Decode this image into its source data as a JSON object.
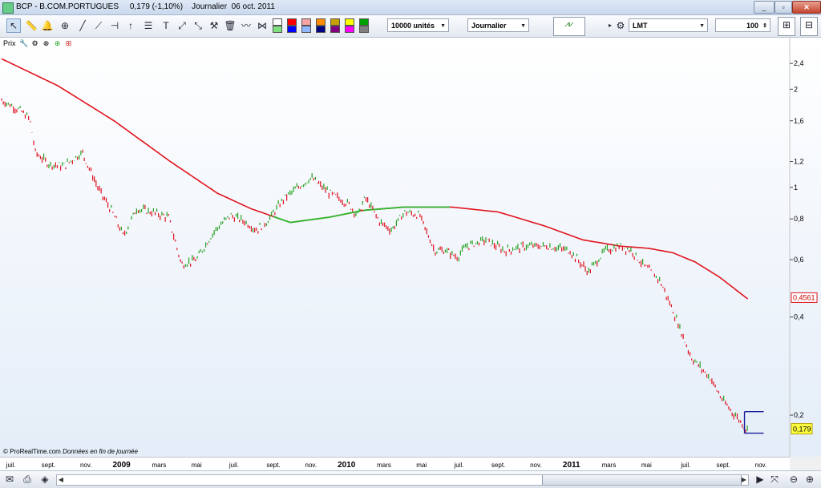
{
  "window": {
    "title": "BCP - B.COM.PORTUGUES     0,179 (-1,10%)    Journalier  06 oct. 2011",
    "minimize": "_",
    "restore": "▫",
    "close": "✕"
  },
  "toolbar": {
    "quantity_dropdown": "10000 unités",
    "period_dropdown": "Journalier",
    "order_type_dropdown": "LMT",
    "quantity_value": "100",
    "colors": [
      "#ffffff",
      "#ff0000",
      "#f7a3a3",
      "#ff8c00",
      "#c8a000",
      "#ffff00",
      "#00a000",
      "#80e080",
      "#0000ff",
      "#8fb8ff",
      "#000080",
      "#800080",
      "#ff00ff",
      "#808080"
    ]
  },
  "chart_panel": {
    "label": "Prix",
    "source_note": "© ProRealTime.com",
    "data_note": "Données en fin de journée"
  },
  "chart_data": {
    "type": "line",
    "instrument": "BCP - B.COM.PORTUGUES",
    "last_price": "0,179",
    "change": "(-1,10%)",
    "scale": "log",
    "ylim": [
      0.165,
      2.6
    ],
    "yticks": [
      {
        "v": 2.4,
        "label": "2,4"
      },
      {
        "v": 2.0,
        "label": "2"
      },
      {
        "v": 1.6,
        "label": "1,6"
      },
      {
        "v": 1.2,
        "label": "1,2"
      },
      {
        "v": 1.0,
        "label": "1"
      },
      {
        "v": 0.8,
        "label": "0,8"
      },
      {
        "v": 0.6,
        "label": "0,6"
      },
      {
        "v": 0.4,
        "label": "0,4"
      },
      {
        "v": 0.2,
        "label": "0,2"
      }
    ],
    "xticks": [
      {
        "t": 0.5,
        "label": "juil.",
        "bold": false
      },
      {
        "t": 2.5,
        "label": "sept.",
        "bold": false
      },
      {
        "t": 4.5,
        "label": "nov.",
        "bold": false
      },
      {
        "t": 6.4,
        "label": "2009",
        "bold": true
      },
      {
        "t": 8.4,
        "label": "mars",
        "bold": false
      },
      {
        "t": 10.4,
        "label": "mai",
        "bold": false
      },
      {
        "t": 12.4,
        "label": "juil.",
        "bold": false
      },
      {
        "t": 14.5,
        "label": "sept.",
        "bold": false
      },
      {
        "t": 16.5,
        "label": "nov.",
        "bold": false
      },
      {
        "t": 18.4,
        "label": "2010",
        "bold": true
      },
      {
        "t": 20.4,
        "label": "mars",
        "bold": false
      },
      {
        "t": 22.4,
        "label": "mai",
        "bold": false
      },
      {
        "t": 24.4,
        "label": "juil.",
        "bold": false
      },
      {
        "t": 26.5,
        "label": "sept.",
        "bold": false
      },
      {
        "t": 28.5,
        "label": "nov.",
        "bold": false
      },
      {
        "t": 30.4,
        "label": "2011",
        "bold": true
      },
      {
        "t": 32.4,
        "label": "mars",
        "bold": false
      },
      {
        "t": 34.4,
        "label": "mai",
        "bold": false
      },
      {
        "t": 36.5,
        "label": "juil.",
        "bold": false
      },
      {
        "t": 38.5,
        "label": "sept.",
        "bold": false
      },
      {
        "t": 40.5,
        "label": "nov.",
        "bold": false
      }
    ],
    "price_series": [
      [
        0,
        1.85
      ],
      [
        1,
        1.72
      ],
      [
        1.5,
        1.62
      ],
      [
        1.8,
        1.28
      ],
      [
        2.5,
        1.18
      ],
      [
        3.3,
        1.16
      ],
      [
        4.3,
        1.28
      ],
      [
        5.2,
        0.98
      ],
      [
        5.9,
        0.84
      ],
      [
        6.5,
        0.71
      ],
      [
        7.2,
        0.86
      ],
      [
        8,
        0.84
      ],
      [
        8.9,
        0.81
      ],
      [
        9.6,
        0.58
      ],
      [
        10.4,
        0.6
      ],
      [
        10.9,
        0.67
      ],
      [
        11.4,
        0.74
      ],
      [
        12.2,
        0.82
      ],
      [
        12.9,
        0.79
      ],
      [
        13.6,
        0.74
      ],
      [
        14.2,
        0.79
      ],
      [
        15.1,
        0.93
      ],
      [
        16.5,
        1.07
      ],
      [
        17.5,
        0.96
      ],
      [
        18.5,
        0.89
      ],
      [
        19,
        0.82
      ],
      [
        19.4,
        0.93
      ],
      [
        20.2,
        0.78
      ],
      [
        20.8,
        0.74
      ],
      [
        21.5,
        0.84
      ],
      [
        22.3,
        0.82
      ],
      [
        23.1,
        0.64
      ],
      [
        23.7,
        0.64
      ],
      [
        24.3,
        0.61
      ],
      [
        24.8,
        0.66
      ],
      [
        25.8,
        0.69
      ],
      [
        26.8,
        0.64
      ],
      [
        28,
        0.66
      ],
      [
        29.1,
        0.66
      ],
      [
        30.3,
        0.64
      ],
      [
        31.3,
        0.55
      ],
      [
        32.2,
        0.64
      ],
      [
        33,
        0.66
      ],
      [
        33.6,
        0.64
      ],
      [
        34.2,
        0.58
      ],
      [
        35.1,
        0.52
      ],
      [
        35.8,
        0.42
      ],
      [
        36.8,
        0.3
      ],
      [
        37.8,
        0.26
      ],
      [
        38.5,
        0.22
      ],
      [
        39.3,
        0.195
      ],
      [
        39.8,
        0.179
      ]
    ],
    "moving_average": [
      [
        0,
        2.48
      ],
      [
        3,
        2.05
      ],
      [
        6,
        1.6
      ],
      [
        9,
        1.2
      ],
      [
        11.5,
        0.96
      ],
      [
        13.3,
        0.86
      ],
      [
        15.4,
        0.78
      ],
      [
        17.5,
        0.81
      ],
      [
        19.3,
        0.85
      ],
      [
        21.5,
        0.87
      ],
      [
        24,
        0.87
      ],
      [
        26.5,
        0.84
      ],
      [
        29,
        0.76
      ],
      [
        31,
        0.69
      ],
      [
        33,
        0.66
      ],
      [
        34.5,
        0.65
      ],
      [
        35.8,
        0.63
      ],
      [
        37,
        0.59
      ],
      [
        38.3,
        0.53
      ],
      [
        39.9,
        0.45
      ]
    ],
    "ma_green_segments": [
      [
        14.5,
        19.3
      ],
      [
        19.3,
        24
      ]
    ],
    "ma_last_label": "0,4561",
    "ma_last_value": 0.4561,
    "price_last_label": "0,179",
    "price_color_up": "#22a01e",
    "price_color_down": "#e0101e",
    "ma_color": "#e0141e",
    "ma_color_up": "#2cb82c",
    "bracket_top": 0.205,
    "bracket_bottom": 0.176,
    "x_range": [
      0,
      42
    ]
  }
}
